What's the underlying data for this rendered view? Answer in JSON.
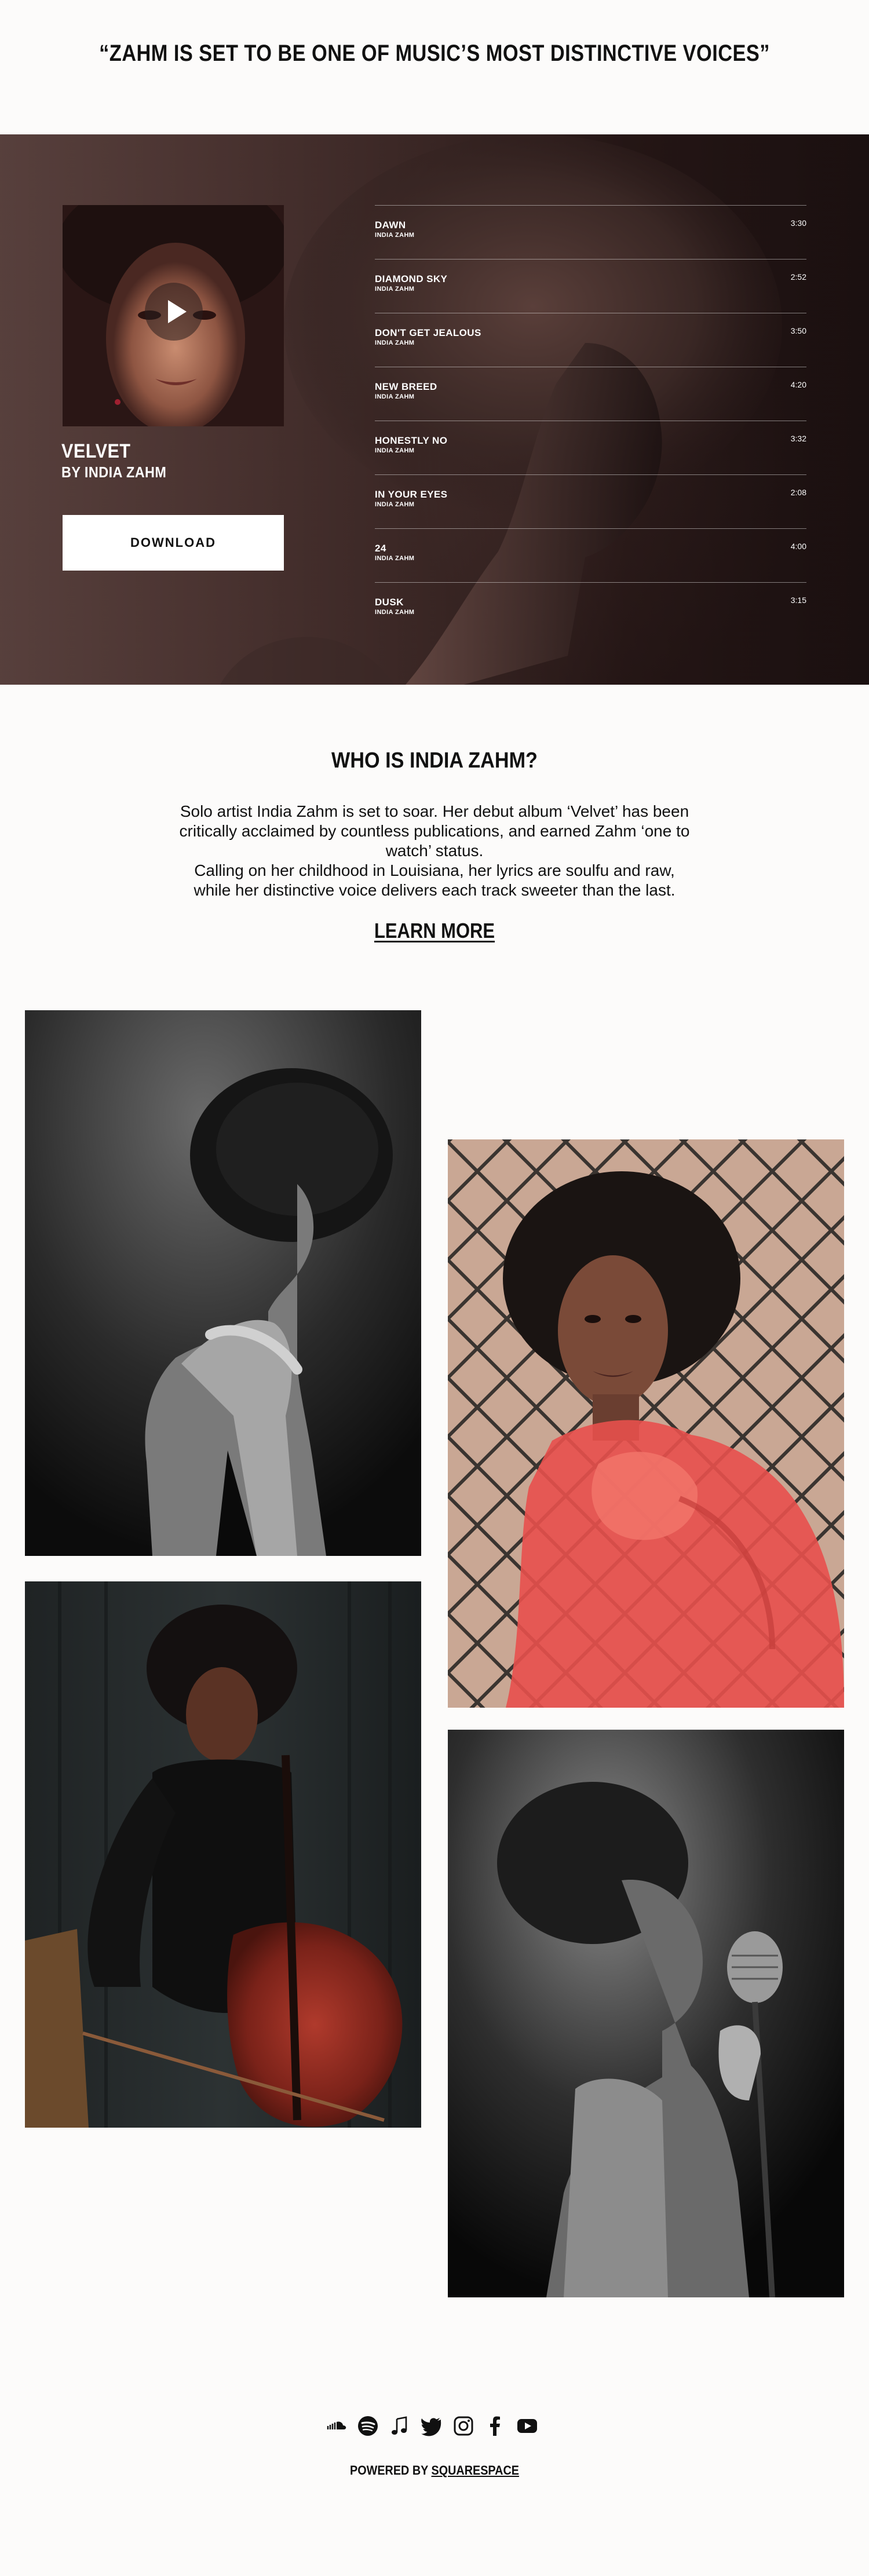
{
  "header": {
    "quote": "“ZAHM IS SET TO BE ONE OF MUSIC’S MOST DISTINCTIVE VOICES”"
  },
  "player": {
    "album_title": "VELVET",
    "album_artist": "BY INDIA ZAHM",
    "download_label": "DOWNLOAD",
    "play_icon": "play-icon",
    "tracks": [
      {
        "name": "DAWN",
        "artist": "INDIA ZAHM",
        "duration": "3:30"
      },
      {
        "name": "DIAMOND SKY",
        "artist": "INDIA ZAHM",
        "duration": "2:52"
      },
      {
        "name": "DON'T GET JEALOUS",
        "artist": "INDIA ZAHM",
        "duration": "3:50"
      },
      {
        "name": "NEW BREED",
        "artist": "INDIA ZAHM",
        "duration": "4:20"
      },
      {
        "name": "HONESTLY NO",
        "artist": "INDIA ZAHM",
        "duration": "3:32"
      },
      {
        "name": "IN YOUR EYES",
        "artist": "INDIA ZAHM",
        "duration": "2:08"
      },
      {
        "name": "24",
        "artist": "INDIA ZAHM",
        "duration": "4:00"
      },
      {
        "name": "DUSK",
        "artist": "INDIA ZAHM",
        "duration": "3:15"
      }
    ]
  },
  "about": {
    "title": "WHO IS INDIA ZAHM?",
    "paragraph_1": "Solo artist India Zahm is set to soar. Her debut album ‘Velvet’ has been critically acclaimed by countless publications, and earned Zahm ‘one to watch’ status.",
    "paragraph_2": "Calling on her childhood in Louisiana, her lyrics are soulfu and raw, while her distinctive voice delivers each track sweeter than the last.",
    "learn_more": "LEARN MORE"
  },
  "footer": {
    "social_icons": [
      "soundcloud-icon",
      "spotify-icon",
      "itunes-icon",
      "twitter-icon",
      "instagram-icon",
      "facebook-icon",
      "youtube-icon"
    ],
    "powered_prefix": "POWERED BY",
    "powered_brand": "SQUARESPACE"
  },
  "colors": {
    "page_background": "#fcfbfa",
    "player_gradient_start": "#7b5c57",
    "player_gradient_end": "#1e1313",
    "text": "#111111",
    "download_button": "#ffffff",
    "scarf_red": "#e8504c"
  }
}
